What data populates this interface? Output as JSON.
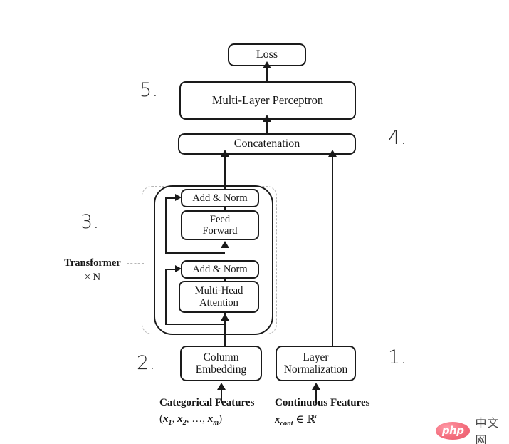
{
  "diagram": {
    "title": "TabTransformer architecture flow diagram",
    "nodes": {
      "loss": "Loss",
      "mlp": "Multi-Layer Perceptron",
      "concat": "Concatenation",
      "add_norm_top": "Add & Norm",
      "feed_forward": "Feed\nForward",
      "feed_forward_line1": "Feed",
      "feed_forward_line2": "Forward",
      "add_norm_bottom": "Add & Norm",
      "attention_line1": "Multi-Head",
      "attention_line2": "Attention",
      "column_embedding_line1": "Column",
      "column_embedding_line2": "Embedding",
      "layer_norm_line1": "Layer",
      "layer_norm_line2": "Normalization"
    },
    "group_label": {
      "name": "Transformer",
      "repeat": "× N"
    },
    "steps": {
      "one": "1.",
      "two": "2.",
      "three": "3.",
      "four": "4.",
      "five": "5."
    },
    "captions": {
      "categorical_title": "Categorical Features",
      "categorical_formula": "(x₁, x₂, …, xₘ)",
      "continuous_title": "Continuous Features",
      "continuous_formula": "x_cont ∈ ℝᶜ"
    },
    "colors": {
      "stroke": "#1a1a1a",
      "dashed": "#b6b6b6",
      "background": "#ffffff",
      "watermark_pink": "#f4707f"
    }
  },
  "watermark": {
    "logo_text": "php",
    "site_text": "中文网"
  }
}
